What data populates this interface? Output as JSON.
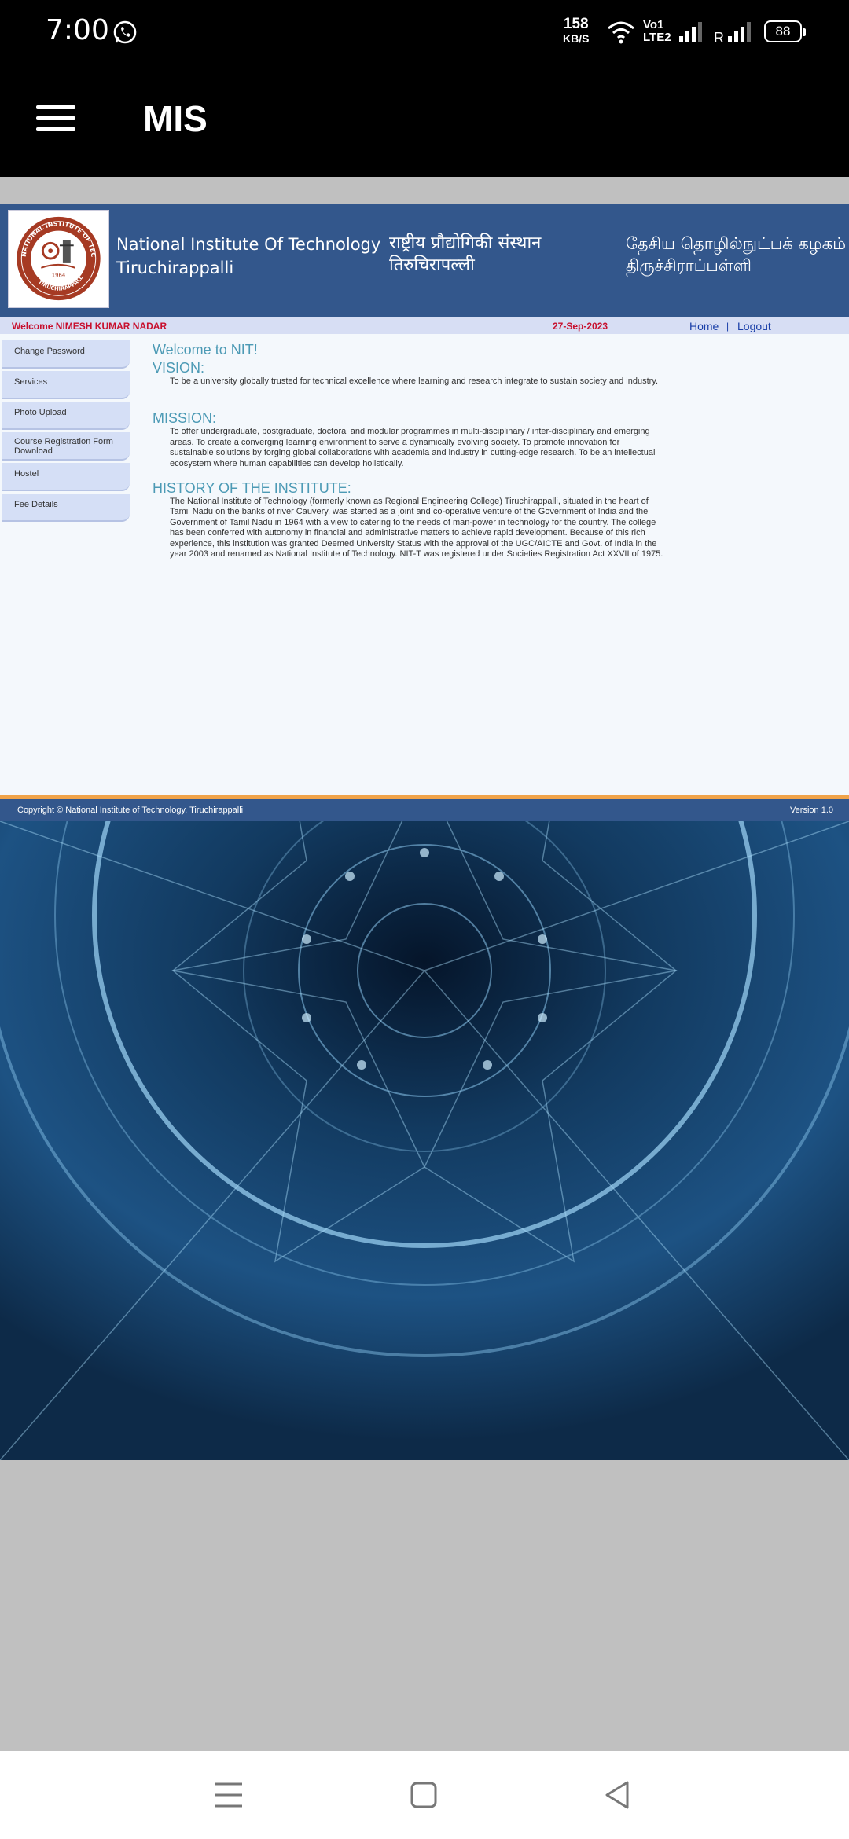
{
  "status_bar": {
    "time": "7:00",
    "net_speed_value": "158",
    "net_speed_unit": "KB/S",
    "volte_line1": "Vo1",
    "volte_line2": "LTE2",
    "roaming": "R",
    "battery": "88"
  },
  "app_bar": {
    "title": "MIS"
  },
  "banner": {
    "name_en_line1": "National Institute Of Technology",
    "name_en_line2": "Tiruchirappalli",
    "name_hi_line1": "राष्ट्रीय प्रौद्योगिकी संस्थान",
    "name_hi_line2": "तिरुचिरापल्ली",
    "name_ta_line1": "தேசிய தொழில்நுட்பக் கழகம்",
    "name_ta_line2": "திருச்சிராப்பள்ளி",
    "logo_year": "1964",
    "logo_ring_text": "NATIONAL INSTITUTE OF TECHNOLOGY",
    "logo_bottom_text": "TIRUCHIRAPPALLI"
  },
  "welcome_bar": {
    "welcome": "Welcome NIMESH KUMAR NADAR",
    "date": "27-Sep-2023",
    "home": "Home",
    "separator": "|",
    "logout": "Logout"
  },
  "sidebar": {
    "items": [
      {
        "label": "Change Password"
      },
      {
        "label": "Services"
      },
      {
        "label": "Photo Upload"
      },
      {
        "label": "Course Registration Form Download"
      },
      {
        "label": "Hostel"
      },
      {
        "label": "Fee Details"
      }
    ]
  },
  "main": {
    "welcome_heading": "Welcome to NIT!",
    "vision_heading": "VISION:",
    "vision_text": "To be a university globally trusted for technical excellence where learning and research integrate to sustain society and industry.",
    "mission_heading": "MISSION:",
    "mission_text": "To offer undergraduate, postgraduate, doctoral and modular programmes in multi-disciplinary / inter-disciplinary and emerging areas. To create a converging learning environment to serve a dynamically evolving society. To promote innovation for sustainable solutions by forging global collaborations with academia and industry in cutting-edge research. To be an intellectual ecosystem where human capabilities can develop holistically.",
    "history_heading": "HISTORY OF THE INSTITUTE:",
    "history_text": "The National Institute of Technology (formerly known as Regional Engineering College) Tiruchirappalli, situated in the heart of Tamil Nadu on the banks of river Cauvery, was started as a joint and co-operative venture of the Government of India and the Government of Tamil Nadu in 1964 with a view to catering to the needs of man-power in technology for the country. The college has been conferred with autonomy in financial and administrative matters to achieve rapid development. Because of this rich experience, this institution was granted Deemed University Status with the approval of the UGC/AICTE and Govt. of India in the year 2003 and renamed as National Institute of Technology. NIT-T was registered under Societies Registration Act XXVII of 1975."
  },
  "footer": {
    "copyright": "Copyright © National Institute of Technology, Tiruchirappalli",
    "version": "Version 1.0"
  },
  "colors": {
    "banner_bg": "#33578c",
    "heading": "#4c9ab5",
    "welcome_red": "#c8102e",
    "link_blue": "#1a3fa8",
    "accent_orange": "#f0a349"
  },
  "icons": {
    "status": [
      "whatsapp-icon",
      "wifi-icon",
      "signal-icon",
      "battery-icon"
    ],
    "app_bar": [
      "hamburger-menu-icon"
    ],
    "nav": [
      "recent-apps-icon",
      "home-icon",
      "back-icon"
    ]
  }
}
